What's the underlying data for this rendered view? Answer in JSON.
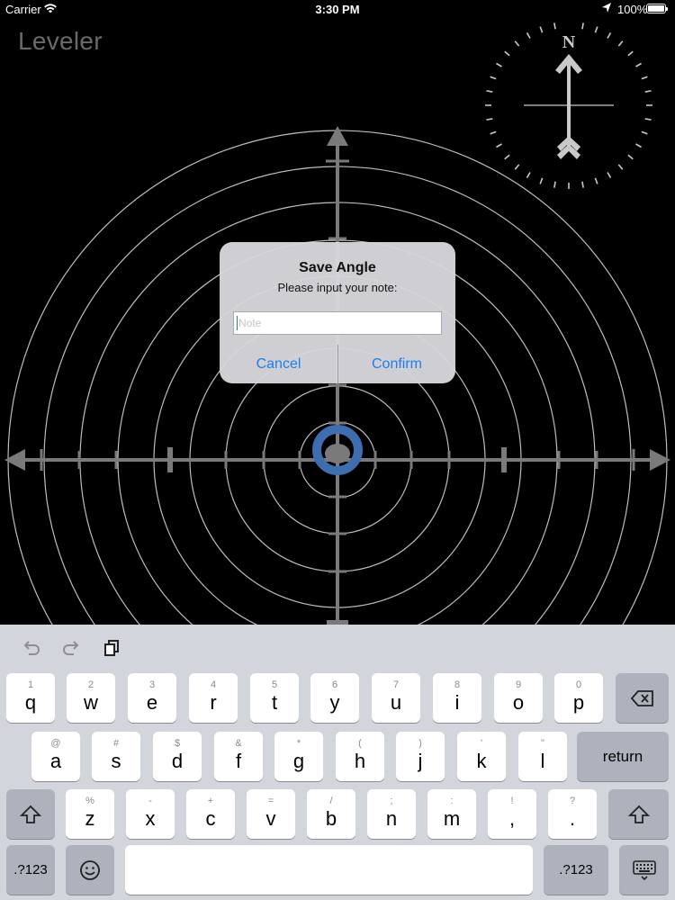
{
  "status_bar": {
    "carrier": "Carrier",
    "time": "3:30 PM",
    "battery": "100%"
  },
  "app": {
    "title": "Leveler"
  },
  "compass": {
    "north_label": "N"
  },
  "dialog": {
    "title": "Save Angle",
    "message": "Please input your note:",
    "input_placeholder": "Note",
    "input_value": "",
    "cancel_label": "Cancel",
    "confirm_label": "Confirm",
    "button_color": "#1a7ff2"
  },
  "keyboard": {
    "toolbar": [
      "undo-icon",
      "redo-icon",
      "paste-icon"
    ],
    "row1": [
      {
        "hint": "1",
        "key": "q"
      },
      {
        "hint": "2",
        "key": "w"
      },
      {
        "hint": "3",
        "key": "e"
      },
      {
        "hint": "4",
        "key": "r"
      },
      {
        "hint": "5",
        "key": "t"
      },
      {
        "hint": "6",
        "key": "y"
      },
      {
        "hint": "7",
        "key": "u"
      },
      {
        "hint": "8",
        "key": "i"
      },
      {
        "hint": "9",
        "key": "o"
      },
      {
        "hint": "0",
        "key": "p"
      }
    ],
    "row2": [
      {
        "hint": "@",
        "key": "a"
      },
      {
        "hint": "#",
        "key": "s"
      },
      {
        "hint": "$",
        "key": "d"
      },
      {
        "hint": "&",
        "key": "f"
      },
      {
        "hint": "*",
        "key": "g"
      },
      {
        "hint": "(",
        "key": "h"
      },
      {
        "hint": ")",
        "key": "j"
      },
      {
        "hint": "'",
        "key": "k"
      },
      {
        "hint": "\"",
        "key": "l"
      }
    ],
    "row3": [
      {
        "hint": "%",
        "key": "z"
      },
      {
        "hint": "-",
        "key": "x"
      },
      {
        "hint": "+",
        "key": "c"
      },
      {
        "hint": "=",
        "key": "v"
      },
      {
        "hint": "/",
        "key": "b"
      },
      {
        "hint": ";",
        "key": "n"
      },
      {
        "hint": ":",
        "key": "m"
      },
      {
        "hint": "!",
        "key": ","
      },
      {
        "hint": "?",
        "key": "."
      }
    ],
    "return_label": "return",
    "numbers_label": ".?123",
    "space_label": ""
  },
  "colors": {
    "bubble": "#3d6fb0",
    "grid": "#ffffff",
    "axis": "#777777"
  }
}
